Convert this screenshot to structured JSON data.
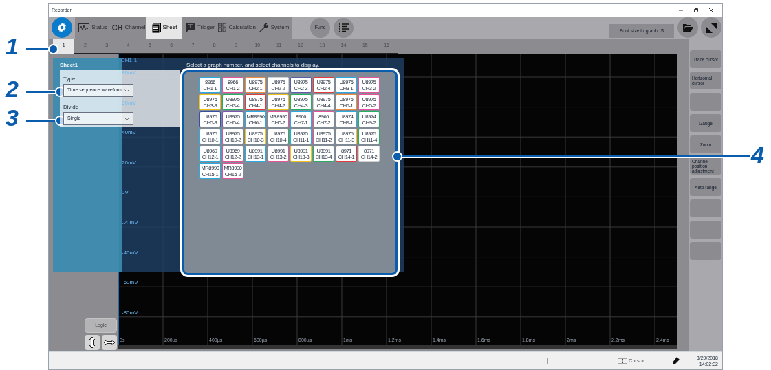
{
  "window": {
    "title": "Recorder"
  },
  "toolbar": {
    "tabs": [
      {
        "label": "Status",
        "selected": false,
        "disabled": true
      },
      {
        "icon_text": "CH",
        "label": "Channel",
        "selected": false,
        "disabled": true
      },
      {
        "label": "Sheet",
        "selected": true,
        "disabled": false
      },
      {
        "label": "Trigger",
        "selected": false,
        "disabled": true
      },
      {
        "label": "Calculation",
        "selected": false,
        "disabled": true
      },
      {
        "label": "System",
        "selected": false,
        "disabled": true
      }
    ],
    "func_button": "Func",
    "font_size_button": "Font size in graph: S"
  },
  "graph_tabs": [
    {
      "label": "1",
      "selected": true
    },
    {
      "label": "2",
      "selected": false
    },
    {
      "label": "3",
      "selected": false
    },
    {
      "label": "4",
      "selected": false
    },
    {
      "label": "5",
      "selected": false
    },
    {
      "label": "6",
      "selected": false
    },
    {
      "label": "7",
      "selected": false
    },
    {
      "label": "8",
      "selected": false
    },
    {
      "label": "9",
      "selected": false
    },
    {
      "label": "10",
      "selected": false
    },
    {
      "label": "11",
      "selected": false
    },
    {
      "label": "12",
      "selected": false
    },
    {
      "label": "13",
      "selected": false
    },
    {
      "label": "14",
      "selected": false
    },
    {
      "label": "15",
      "selected": false
    },
    {
      "label": "16",
      "selected": false
    }
  ],
  "sheet_panel": {
    "title": "Sheet1",
    "type_label": "Type",
    "type_value": "Time sequence waveform",
    "divide_label": "Divide",
    "divide_value": "Single"
  },
  "channel_picker": {
    "instruction": "Select a graph number, and select channels to display.",
    "channels": [
      {
        "model": "8966",
        "channel": "CH1-1",
        "color": "#29abe2"
      },
      {
        "model": "8966",
        "channel": "CH1-2",
        "color": "#e6539a"
      },
      {
        "model": "U8975",
        "channel": "CH2-1",
        "color": "#f08a3c"
      },
      {
        "model": "U8975",
        "channel": "CH2-2",
        "color": "#d0d0d0"
      },
      {
        "model": "U8975",
        "channel": "CH2-3",
        "color": "#5b5fa8"
      },
      {
        "model": "U8975",
        "channel": "CH2-4",
        "color": "#e03c3c"
      },
      {
        "model": "U8975",
        "channel": "CH3-1",
        "color": "#29abe2"
      },
      {
        "model": "U8975",
        "channel": "CH3-2",
        "color": "#e6539a"
      },
      {
        "model": "U8975",
        "channel": "CH3-3",
        "color": "#f0c419"
      },
      {
        "model": "U8975",
        "channel": "CH3-4",
        "color": "#27ae60"
      },
      {
        "model": "U8975",
        "channel": "CH4-1",
        "color": "#e03c3c"
      },
      {
        "model": "U8975",
        "channel": "CH4-2",
        "color": "#f0c419"
      },
      {
        "model": "U8975",
        "channel": "CH4-3",
        "color": "#27ae60"
      },
      {
        "model": "U8975",
        "channel": "CH4-4",
        "color": "#d0d0d0"
      },
      {
        "model": "U8975",
        "channel": "CH5-1",
        "color": "#f08a3c"
      },
      {
        "model": "U8975",
        "channel": "CH5-2",
        "color": "#e6539a"
      },
      {
        "model": "U8975",
        "channel": "CH5-3",
        "color": "#3b4fa0"
      },
      {
        "model": "U8975",
        "channel": "CH5-4",
        "color": "#7a5ab0"
      },
      {
        "model": "MR8990",
        "channel": "CH6-1",
        "color": "#29abe2"
      },
      {
        "model": "MR8990",
        "channel": "CH6-2",
        "color": "#e6539a"
      },
      {
        "model": "8966",
        "channel": "CH7-1",
        "color": "#29abe2"
      },
      {
        "model": "8966",
        "channel": "CH7-2",
        "color": "#e6539a"
      },
      {
        "model": "U8974",
        "channel": "CH9-1",
        "color": "#29abe2"
      },
      {
        "model": "U8974",
        "channel": "CH9-2",
        "color": "#27ae60"
      },
      {
        "model": "U8975",
        "channel": "CH10-1",
        "color": "#29abe2"
      },
      {
        "model": "U8975",
        "channel": "CH10-2",
        "color": "#e6539a"
      },
      {
        "model": "U8975",
        "channel": "CH10-3",
        "color": "#f0c419"
      },
      {
        "model": "U8975",
        "channel": "CH10-4",
        "color": "#27ae60"
      },
      {
        "model": "U8975",
        "channel": "CH11-1",
        "color": "#29abe2"
      },
      {
        "model": "U8975",
        "channel": "CH11-2",
        "color": "#e6539a"
      },
      {
        "model": "U8975",
        "channel": "CH11-3",
        "color": "#f0c419"
      },
      {
        "model": "U8975",
        "channel": "CH11-4",
        "color": "#27ae60"
      },
      {
        "model": "U8969",
        "channel": "CH12-1",
        "color": "#29abe2"
      },
      {
        "model": "U8969",
        "channel": "CH12-2",
        "color": "#e6539a"
      },
      {
        "model": "U8991",
        "channel": "CH13-1",
        "color": "#29abe2"
      },
      {
        "model": "U8991",
        "channel": "CH13-2",
        "color": "#e6539a"
      },
      {
        "model": "U8991",
        "channel": "CH13-3",
        "color": "#f0c419"
      },
      {
        "model": "U8991",
        "channel": "CH13-4",
        "color": "#27ae60"
      },
      {
        "model": "8971",
        "channel": "CH14-1",
        "color": "#e03c3c"
      },
      {
        "model": "8971",
        "channel": "CH14-2",
        "color": "#d0d0d0"
      },
      {
        "model": "MR8990",
        "channel": "CH15-1",
        "color": "#29abe2"
      },
      {
        "model": "MR8990",
        "channel": "CH15-2",
        "color": "#e6539a"
      }
    ]
  },
  "graph": {
    "channel_label": "CH1-1",
    "y_labels": [
      "80mV",
      "60mV",
      "40mV",
      "20mV",
      "0V",
      "-20mV",
      "-40mV",
      "-60mV",
      "-80mV"
    ],
    "x_labels": [
      "0s",
      "200µs",
      "400µs",
      "600µs",
      "800µs",
      "1ms",
      "1.2ms",
      "1.4ms",
      "1.6ms",
      "1.8ms",
      "2ms",
      "2.2ms",
      "2.4ms"
    ]
  },
  "side_buttons": [
    {
      "kind": "labeled",
      "label": "Trace cursor"
    },
    {
      "kind": "labeled",
      "label": "Horizontal cursor"
    },
    {
      "kind": "blank"
    },
    {
      "kind": "labeled",
      "label": "Gauge"
    },
    {
      "kind": "labeled",
      "label": "Zoom"
    },
    {
      "kind": "labeled",
      "label": "Channel position adjustment"
    },
    {
      "kind": "labeled",
      "label": "Auto range"
    },
    {
      "kind": "blank"
    },
    {
      "kind": "blank"
    },
    {
      "kind": "blank"
    }
  ],
  "logic_button": {
    "label": "Logic",
    "disabled": true
  },
  "status_bar": {
    "cursor_label": "Cursor",
    "date": "8/29/2018",
    "time": "14:02:32"
  },
  "callouts": [
    {
      "label": "1"
    },
    {
      "label": "2"
    },
    {
      "label": "3"
    },
    {
      "label": "4"
    }
  ]
}
